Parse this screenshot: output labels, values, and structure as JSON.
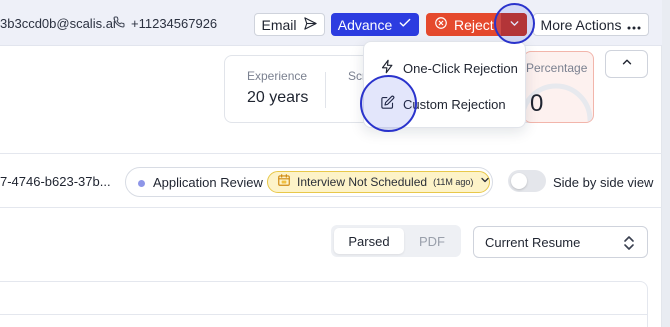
{
  "header": {
    "email": "3b3ccd0b@scalis.ai",
    "phone": "+11234567926",
    "email_button": "Email",
    "advance_button": "Advance",
    "reject_button": "Reject",
    "more_actions_button": "More Actions"
  },
  "stats": {
    "experience_label": "Experience",
    "experience_value": "20 years",
    "score_label": "Scr",
    "percentage_label": "Percentage",
    "percentage_value": "0"
  },
  "reject_menu": {
    "items": [
      {
        "label": "One-Click Rejection",
        "icon": "lightning-icon"
      },
      {
        "label": "Custom Rejection",
        "icon": "edit-icon"
      }
    ]
  },
  "application": {
    "id_text": "7-4746-b623-37b...",
    "stage": "Application Review",
    "interview_status": "Interview Not Scheduled",
    "interview_time": "(11M ago)",
    "side_by_side_label": "Side by side view",
    "side_by_side_on": false
  },
  "resume_view": {
    "tabs": [
      "Parsed",
      "PDF"
    ],
    "active_tab": "Parsed",
    "selected_resume": "Current Resume"
  },
  "colors": {
    "advance": "#2c3ce0",
    "reject": "#e5492d",
    "reject_split": "#c8311c",
    "interview_badge": "#fdf3c8",
    "highlight_ring": "#2a33cc"
  }
}
